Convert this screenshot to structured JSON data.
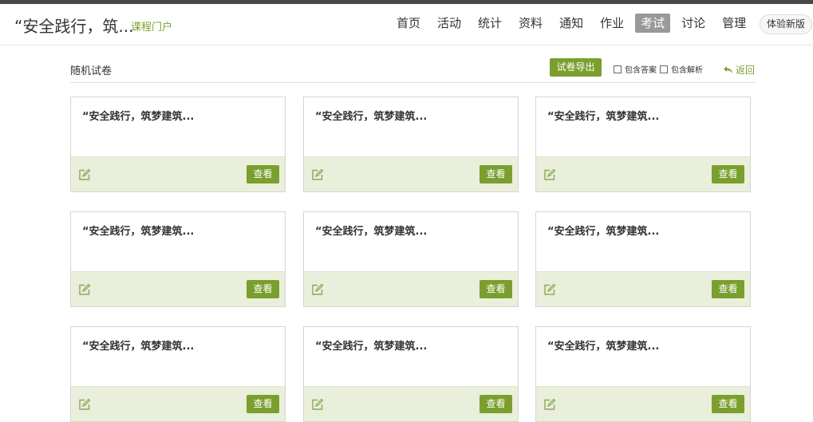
{
  "header": {
    "course_title": "“安全践行，筑...",
    "portal_link": "课程门户",
    "nav": [
      {
        "label": "首页",
        "active": false
      },
      {
        "label": "活动",
        "active": false
      },
      {
        "label": "统计",
        "active": false
      },
      {
        "label": "资料",
        "active": false
      },
      {
        "label": "通知",
        "active": false
      },
      {
        "label": "作业",
        "active": false
      },
      {
        "label": "考试",
        "active": true
      },
      {
        "label": "讨论",
        "active": false
      },
      {
        "label": "管理",
        "active": false
      }
    ],
    "new_version": "体验新版"
  },
  "toolbar": {
    "page_title": "随机试卷",
    "export_label": "试卷导出",
    "include_answer": "包含答案",
    "include_analysis": "包含解析",
    "back_label": "返回"
  },
  "cards": [
    {
      "title": "“安全践行，筑梦建筑...",
      "view_label": "查看"
    },
    {
      "title": "“安全践行，筑梦建筑...",
      "view_label": "查看"
    },
    {
      "title": "“安全践行，筑梦建筑...",
      "view_label": "查看"
    },
    {
      "title": "“安全践行，筑梦建筑...",
      "view_label": "查看"
    },
    {
      "title": "“安全践行，筑梦建筑...",
      "view_label": "查看"
    },
    {
      "title": "“安全践行，筑梦建筑...",
      "view_label": "查看"
    },
    {
      "title": "“安全践行，筑梦建筑...",
      "view_label": "查看"
    },
    {
      "title": "“安全践行，筑梦建筑...",
      "view_label": "查看"
    },
    {
      "title": "“安全践行，筑梦建筑...",
      "view_label": "查看"
    }
  ],
  "colors": {
    "accent": "#7b9f2e",
    "card_footer": "#e9efda",
    "nav_active": "#999999"
  }
}
